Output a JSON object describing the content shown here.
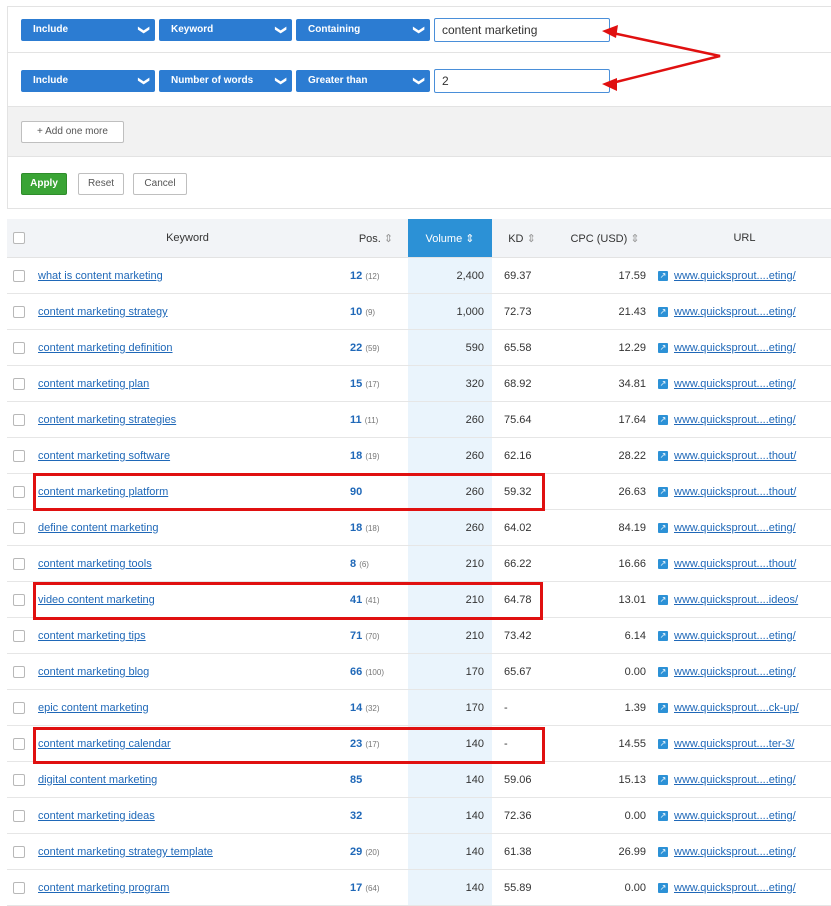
{
  "filters": [
    {
      "mode": "Include",
      "field": "Keyword",
      "op": "Containing",
      "value": "content marketing"
    },
    {
      "mode": "Include",
      "field": "Number of words",
      "op": "Greater than",
      "value": "2"
    }
  ],
  "add_more": "Add one more",
  "actions": {
    "apply": "Apply",
    "reset": "Reset",
    "cancel": "Cancel"
  },
  "table": {
    "headers": {
      "keyword": "Keyword",
      "pos": "Pos.",
      "volume": "Volume",
      "kd": "KD",
      "cpc": "CPC (USD)",
      "url": "URL"
    },
    "rows": [
      {
        "keyword": "what is content marketing",
        "pos": "12",
        "prev": "(12)",
        "volume": "2,400",
        "kd": "69.37",
        "cpc": "17.59",
        "url": "www.quicksprout....eting/"
      },
      {
        "keyword": "content marketing strategy",
        "pos": "10",
        "prev": "(9)",
        "volume": "1,000",
        "kd": "72.73",
        "cpc": "21.43",
        "url": "www.quicksprout....eting/"
      },
      {
        "keyword": "content marketing definition",
        "pos": "22",
        "prev": "(59)",
        "volume": "590",
        "kd": "65.58",
        "cpc": "12.29",
        "url": "www.quicksprout....eting/"
      },
      {
        "keyword": "content marketing plan",
        "pos": "15",
        "prev": "(17)",
        "volume": "320",
        "kd": "68.92",
        "cpc": "34.81",
        "url": "www.quicksprout....eting/"
      },
      {
        "keyword": "content marketing strategies",
        "pos": "11",
        "prev": "(11)",
        "volume": "260",
        "kd": "75.64",
        "cpc": "17.64",
        "url": "www.quicksprout....eting/"
      },
      {
        "keyword": "content marketing software",
        "pos": "18",
        "prev": "(19)",
        "volume": "260",
        "kd": "62.16",
        "cpc": "28.22",
        "url": "www.quicksprout....thout/"
      },
      {
        "keyword": "content marketing platform",
        "pos": "90",
        "prev": "",
        "volume": "260",
        "kd": "59.32",
        "cpc": "26.63",
        "url": "www.quicksprout....thout/"
      },
      {
        "keyword": "define content marketing",
        "pos": "18",
        "prev": "(18)",
        "volume": "260",
        "kd": "64.02",
        "cpc": "84.19",
        "url": "www.quicksprout....eting/"
      },
      {
        "keyword": "content marketing tools",
        "pos": "8",
        "prev": "(6)",
        "volume": "210",
        "kd": "66.22",
        "cpc": "16.66",
        "url": "www.quicksprout....thout/"
      },
      {
        "keyword": "video content marketing",
        "pos": "41",
        "prev": "(41)",
        "volume": "210",
        "kd": "64.78",
        "cpc": "13.01",
        "url": "www.quicksprout....ideos/"
      },
      {
        "keyword": "content marketing tips",
        "pos": "71",
        "prev": "(70)",
        "volume": "210",
        "kd": "73.42",
        "cpc": "6.14",
        "url": "www.quicksprout....eting/"
      },
      {
        "keyword": "content marketing blog",
        "pos": "66",
        "prev": "(100)",
        "volume": "170",
        "kd": "65.67",
        "cpc": "0.00",
        "url": "www.quicksprout....eting/"
      },
      {
        "keyword": "epic content marketing",
        "pos": "14",
        "prev": "(32)",
        "volume": "170",
        "kd": "-",
        "cpc": "1.39",
        "url": "www.quicksprout....ck-up/"
      },
      {
        "keyword": "content marketing calendar",
        "pos": "23",
        "prev": "(17)",
        "volume": "140",
        "kd": "-",
        "cpc": "14.55",
        "url": "www.quicksprout....ter-3/"
      },
      {
        "keyword": "digital content marketing",
        "pos": "85",
        "prev": "",
        "volume": "140",
        "kd": "59.06",
        "cpc": "15.13",
        "url": "www.quicksprout....eting/"
      },
      {
        "keyword": "content marketing ideas",
        "pos": "32",
        "prev": "",
        "volume": "140",
        "kd": "72.36",
        "cpc": "0.00",
        "url": "www.quicksprout....eting/"
      },
      {
        "keyword": "content marketing strategy template",
        "pos": "29",
        "prev": "(20)",
        "volume": "140",
        "kd": "61.38",
        "cpc": "26.99",
        "url": "www.quicksprout....eting/"
      },
      {
        "keyword": "content marketing program",
        "pos": "17",
        "prev": "(64)",
        "volume": "140",
        "kd": "55.89",
        "cpc": "0.00",
        "url": "www.quicksprout....eting/"
      }
    ]
  }
}
